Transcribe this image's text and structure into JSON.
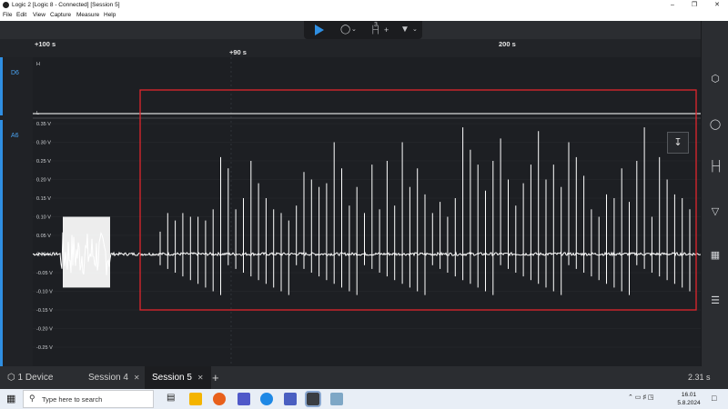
{
  "window": {
    "title": "Logic 2 [Logic 8 - Connected] [Session 5]"
  },
  "menu": {
    "items": [
      "File",
      "Edit",
      "View",
      "Capture",
      "Measure",
      "Help"
    ]
  },
  "toolbar": {
    "play_icon": "play-icon",
    "trigger_icon": "trigger-icon",
    "time_icon": "timing-marker-icon",
    "time_count": "3",
    "marker_icon": "marker-icon"
  },
  "ruler": {
    "left_label": "+100 s",
    "mid_label": "+90 s",
    "right_label": "200 s"
  },
  "channels": {
    "digital": {
      "name": "D6",
      "high": "H",
      "low": "L"
    },
    "analog": {
      "name": "A6",
      "ticks": [
        "0.35 V",
        "0.30 V",
        "0.25 V",
        "0.20 V",
        "0.15 V",
        "0.10 V",
        "0.05 V",
        "0.00 V",
        "-0.05 V",
        "-0.10 V",
        "-0.15 V",
        "-0.20 V",
        "-0.25 V"
      ]
    }
  },
  "tabs": {
    "device": "1 Device",
    "session4": "Session 4",
    "session5": "Session 5",
    "add": "+",
    "capture_time": "2.31 s"
  },
  "taskbar": {
    "search_placeholder": "Type here to search",
    "time": "16.01",
    "date": "5.8.2024"
  },
  "colors": {
    "accent": "#2f8fe3",
    "highlight_box": "#e0262d",
    "signal": "#ffffff"
  }
}
